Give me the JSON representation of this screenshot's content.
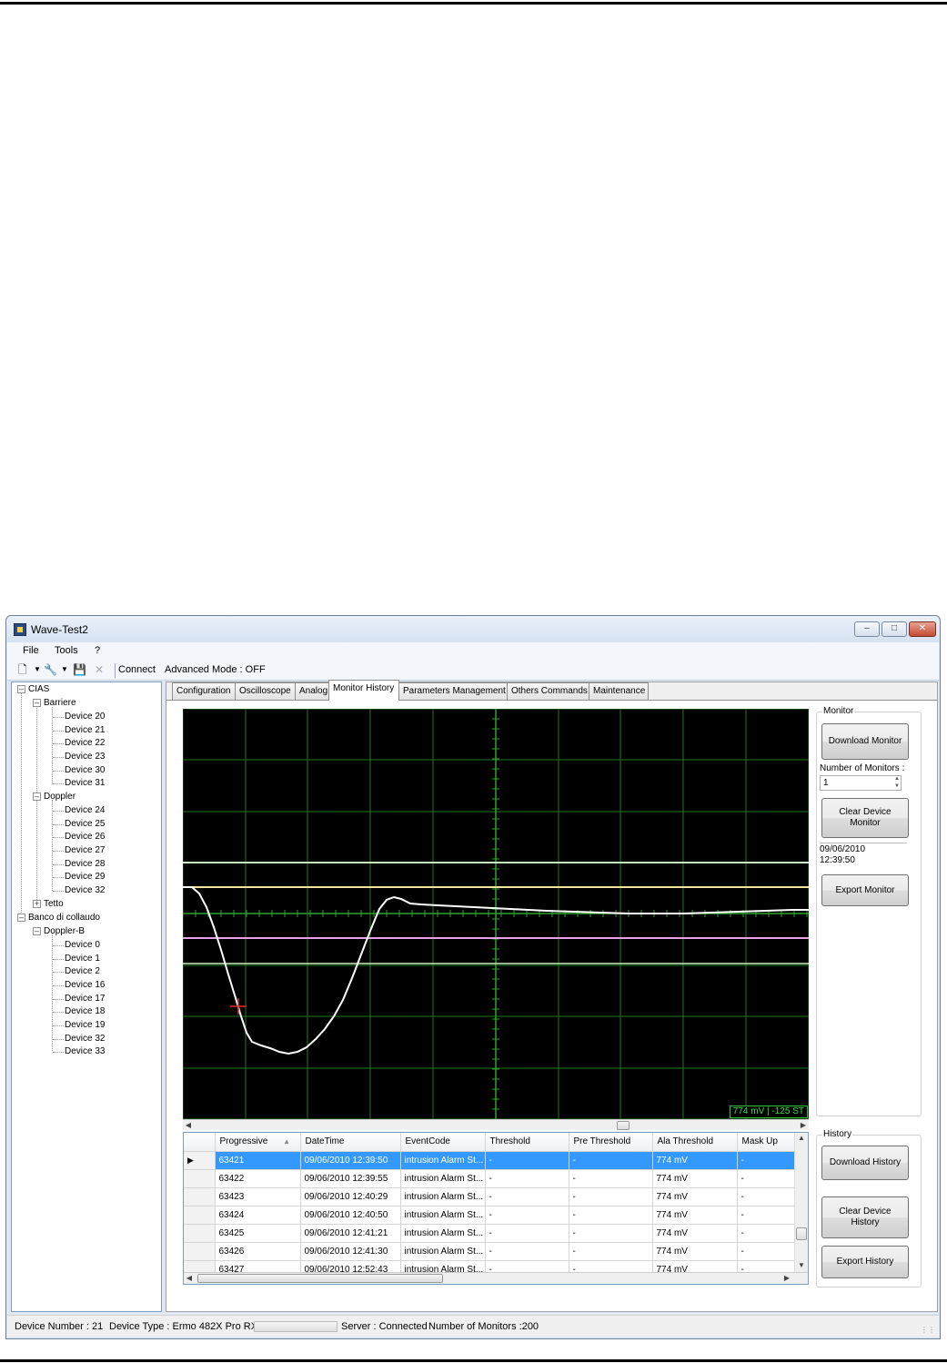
{
  "window": {
    "title": "Wave-Test2"
  },
  "menu": {
    "items": [
      "File",
      "Tools",
      "?"
    ]
  },
  "toolbar": {
    "connect_label": "Connect",
    "mode_label": "Advanced Mode : OFF"
  },
  "tree": {
    "root1": "CIAS",
    "group_barriere": "Barriere",
    "barriere_devices": [
      "Device 20",
      "Device 21",
      "Device 22",
      "Device 23",
      "Device 30",
      "Device 31"
    ],
    "group_doppler": "Doppler",
    "doppler_devices": [
      "Device 24",
      "Device 25",
      "Device 26",
      "Device 27",
      "Device 28",
      "Device 29",
      "Device 32"
    ],
    "group_tetto": "Tetto",
    "root2": "Banco di collaudo",
    "group_dopplerb": "Doppler-B",
    "dopplerb_devices": [
      "Device 0",
      "Device 1",
      "Device 2",
      "Device 16",
      "Device 17",
      "Device 18",
      "Device 19",
      "Device 32",
      "Device 33"
    ]
  },
  "tabs": [
    "Configuration",
    "Oscilloscope",
    "Analog",
    "Monitor History",
    "Parameters Management",
    "Others Commands",
    "Maintenance"
  ],
  "active_tab": "Monitor History",
  "scope": {
    "readout": "774 mV | -125 ST",
    "colors": {
      "background": "#000000",
      "grid": "#1f7a1f",
      "trace": "#ffffff",
      "upper_line": "#c8f0c0",
      "alarm_line": "#f3e3a0",
      "lower_line": "#e9a0e9"
    }
  },
  "monitor_panel": {
    "group_label": "Monitor",
    "download_button": "Download Monitor",
    "count_label": "Number of Monitors :",
    "count_value": "1",
    "clear_button": "Clear Device Monitor",
    "timestamp": "09/06/2010\n12:39:50",
    "export_button": "Export Monitor"
  },
  "history_panel": {
    "group_label": "History",
    "download_button": "Download History",
    "clear_button": "Clear Device History",
    "export_button": "Export History"
  },
  "table": {
    "columns": [
      "Progressive",
      "DateTime",
      "EventCode",
      "Threshold",
      "Pre Threshold",
      "Ala Threshold",
      "Mask Up"
    ],
    "rows": [
      [
        "63421",
        "09/06/2010 12:39:50",
        "intrusion Alarm St...",
        "-",
        "-",
        "774 mV",
        "-"
      ],
      [
        "63422",
        "09/06/2010 12:39:55",
        "intrusion Alarm St...",
        "-",
        "-",
        "774 mV",
        "-"
      ],
      [
        "63423",
        "09/06/2010 12:40:29",
        "intrusion Alarm St...",
        "-",
        "-",
        "774 mV",
        "-"
      ],
      [
        "63424",
        "09/06/2010 12:40:50",
        "intrusion Alarm St...",
        "-",
        "-",
        "774 mV",
        "-"
      ],
      [
        "63425",
        "09/06/2010 12:41:21",
        "intrusion Alarm St...",
        "-",
        "-",
        "774 mV",
        "-"
      ],
      [
        "63426",
        "09/06/2010 12:41:30",
        "intrusion Alarm St...",
        "-",
        "-",
        "774 mV",
        "-"
      ],
      [
        "63427",
        "09/06/2010 12:52:43",
        "intrusion Alarm St...",
        "-",
        "-",
        "774 mV",
        "-"
      ]
    ],
    "selected_row": 0
  },
  "status": {
    "device_number": "Device Number : 21",
    "device_type": "Device Type : Ermo 482X Pro RX",
    "server": "Server : Connected",
    "monitors": "Number of Monitors :200"
  }
}
